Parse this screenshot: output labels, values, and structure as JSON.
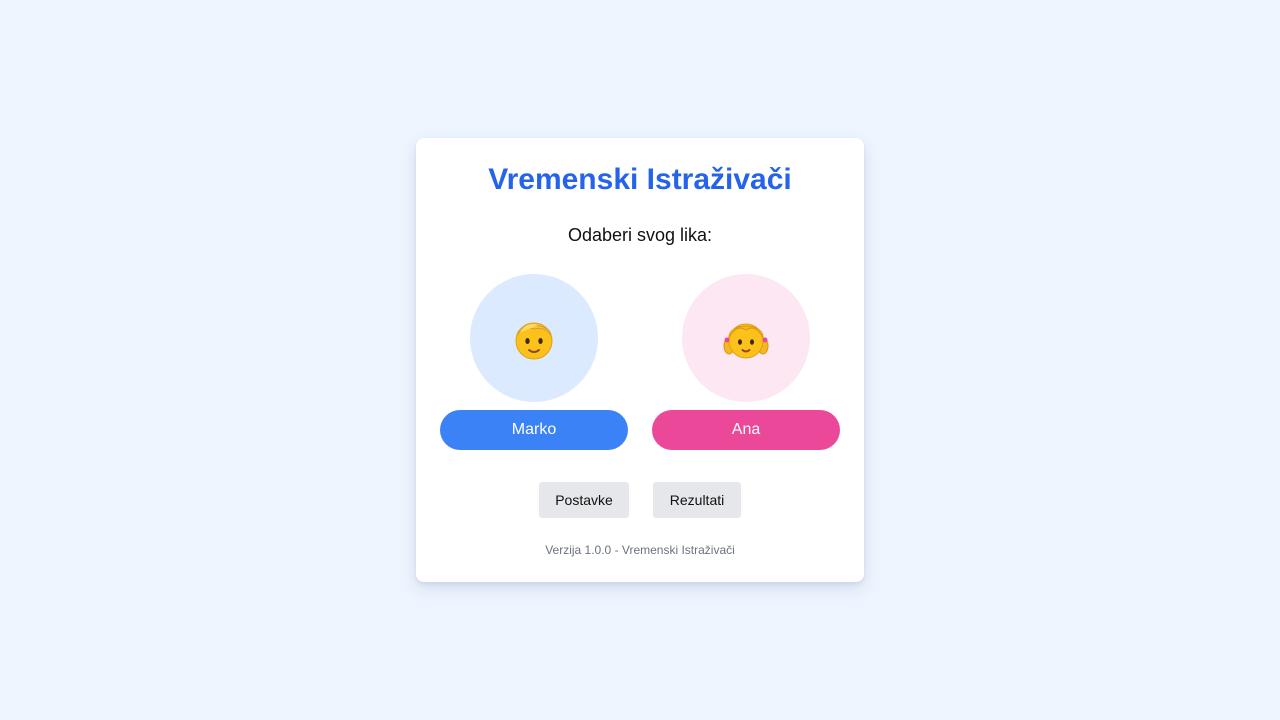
{
  "app": {
    "title": "Vremenski Istraživači",
    "prompt": "Odaberi svog lika:"
  },
  "characters": [
    {
      "name": "Marko",
      "icon": "boy-face-icon",
      "color": "#3b82f6",
      "avatar_bg": "#dbeafe"
    },
    {
      "name": "Ana",
      "icon": "girl-face-icon",
      "color": "#ec4899",
      "avatar_bg": "#fce7f3"
    }
  ],
  "actions": {
    "settings_label": "Postavke",
    "results_label": "Rezultati"
  },
  "footer": {
    "text": "Verzija 1.0.0 - Vremenski Istraživači"
  },
  "colors": {
    "background": "#eef5ff",
    "title": "#2563eb"
  }
}
